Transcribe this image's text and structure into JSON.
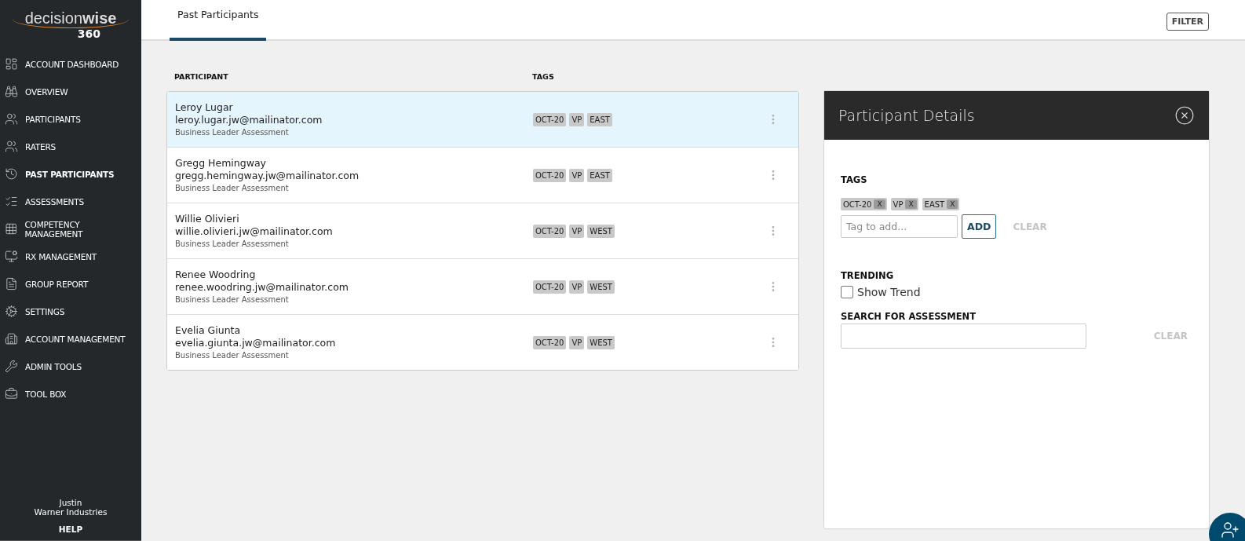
{
  "logo": {
    "word_light": "decision",
    "word_bold": "wise",
    "number": "360"
  },
  "sidebar": {
    "items": [
      {
        "label": "ACCOUNT DASHBOARD",
        "selected": false
      },
      {
        "label": "OVERVIEW",
        "selected": false
      },
      {
        "label": "PARTICIPANTS",
        "selected": false
      },
      {
        "label": "RATERS",
        "selected": false
      },
      {
        "label": "PAST PARTICIPANTS",
        "selected": true
      },
      {
        "label": "ASSESSMENTS",
        "selected": false
      },
      {
        "label": "COMPETENCY MANAGEMENT",
        "selected": false
      },
      {
        "label": "RX MANAGEMENT",
        "selected": false
      },
      {
        "label": "GROUP REPORT",
        "selected": false
      },
      {
        "label": "SETTINGS",
        "selected": false
      },
      {
        "label": "ACCOUNT MANAGEMENT",
        "selected": false
      },
      {
        "label": "ADMIN TOOLS",
        "selected": false
      },
      {
        "label": "TOOL BOX",
        "selected": false
      }
    ],
    "user_name": "Justin",
    "company": "Warner Industries",
    "help": "HELP"
  },
  "tabs": [
    {
      "label": "Past Participants",
      "selected": true
    }
  ],
  "filter_button": "FILTER",
  "table": {
    "columns": [
      "PARTICIPANT",
      "TAGS"
    ],
    "rows": [
      {
        "name": "Leroy Lugar",
        "email": "leroy.lugar.jw@mailinator.com",
        "assessment": "Business Leader Assessment",
        "tags": [
          "OCT-20",
          "VP",
          "EAST"
        ],
        "selected": true
      },
      {
        "name": "Gregg Hemingway",
        "email": "gregg.hemingway.jw@mailinator.com",
        "assessment": "Business Leader Assessment",
        "tags": [
          "OCT-20",
          "VP",
          "EAST"
        ],
        "selected": false
      },
      {
        "name": "Willie Olivieri",
        "email": "willie.olivieri.jw@mailinator.com",
        "assessment": "Business Leader Assessment",
        "tags": [
          "OCT-20",
          "VP",
          "WEST"
        ],
        "selected": false
      },
      {
        "name": "Renee Woodring",
        "email": "renee.woodring.jw@mailinator.com",
        "assessment": "Business Leader Assessment",
        "tags": [
          "OCT-20",
          "VP",
          "WEST"
        ],
        "selected": false
      },
      {
        "name": "Evelia Giunta",
        "email": "evelia.giunta.jw@mailinator.com",
        "assessment": "Business Leader Assessment",
        "tags": [
          "OCT-20",
          "VP",
          "WEST"
        ],
        "selected": false
      }
    ]
  },
  "details": {
    "title": "Participant Details",
    "tags_heading": "TAGS",
    "tags": [
      {
        "label": "OCT-20",
        "remove": "X"
      },
      {
        "label": "VP",
        "remove": "X"
      },
      {
        "label": "EAST",
        "remove": "X"
      }
    ],
    "tag_input": {
      "placeholder": "Tag to add..."
    },
    "add_button": "ADD",
    "clear_tags": "CLEAR",
    "trending_heading": "TRENDING",
    "show_trend": {
      "label": "Show Trend",
      "checked": false
    },
    "search_label": "SEARCH FOR ASSESSMENT",
    "clear_search": "CLEAR"
  }
}
